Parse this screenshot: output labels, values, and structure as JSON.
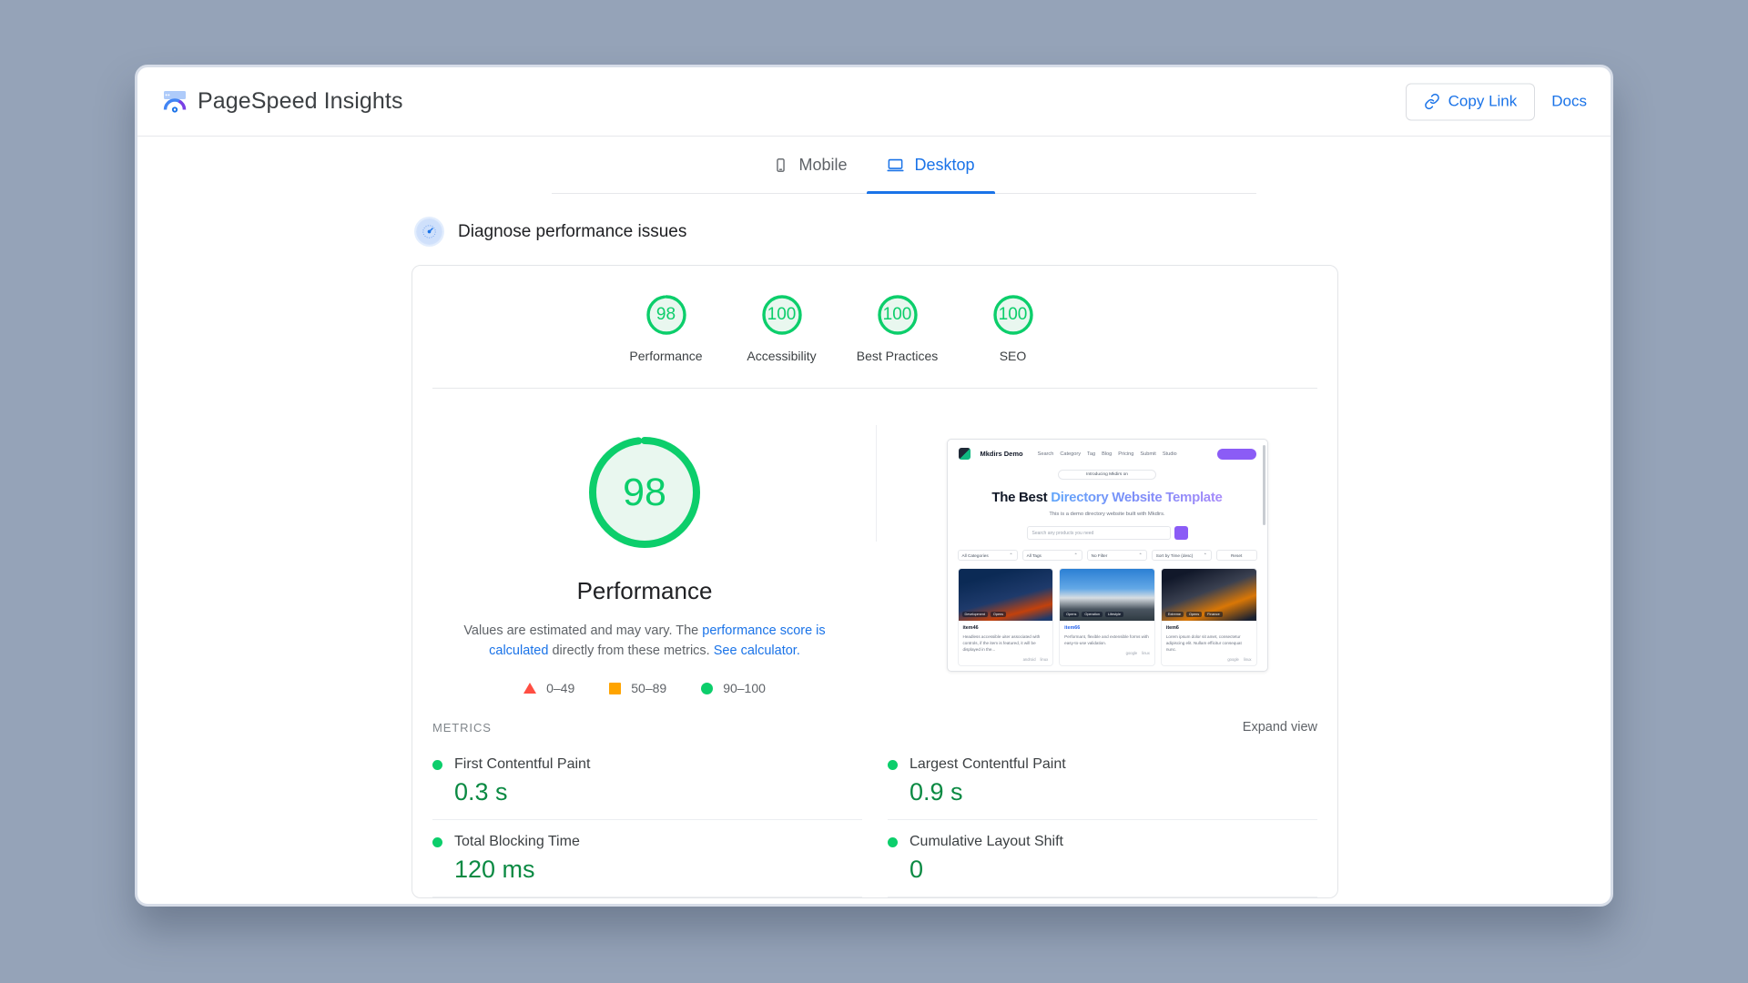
{
  "header": {
    "brand_title": "PageSpeed Insights",
    "logo_icon": "pagespeed-logo-icon",
    "copy_link_label": "Copy Link",
    "copy_link_icon": "link-icon",
    "docs_label": "Docs"
  },
  "tabs": [
    {
      "label": "Mobile",
      "icon": "mobile-phone-icon",
      "active": false
    },
    {
      "label": "Desktop",
      "icon": "desktop-monitor-icon",
      "active": true
    }
  ],
  "diagnose": {
    "title": "Diagnose performance issues",
    "icon": "speedometer-icon"
  },
  "category_scores": [
    {
      "label": "Performance",
      "value": "98",
      "color": "#0cce6b"
    },
    {
      "label": "Accessibility",
      "value": "100",
      "color": "#0cce6b"
    },
    {
      "label": "Best Practices",
      "value": "100",
      "color": "#0cce6b"
    },
    {
      "label": "SEO",
      "value": "100",
      "color": "#0cce6b"
    }
  ],
  "main_score": {
    "value": "98",
    "label": "Performance",
    "desc_part1": "Values are estimated and may vary. The ",
    "desc_link1": "performance score is calculated",
    "desc_part2": " directly from these metrics. ",
    "desc_link2": "See calculator.",
    "ring_color": "#0cce6b",
    "fill_color": "#e9f7ef"
  },
  "legend": [
    {
      "shape": "triangle",
      "color": "#ff4e42",
      "range": "0–49"
    },
    {
      "shape": "square",
      "color": "#ffa400",
      "range": "50–89"
    },
    {
      "shape": "circle",
      "color": "#0cce6b",
      "range": "90–100"
    }
  ],
  "metrics_section": {
    "title": "METRICS",
    "expand_label": "Expand view",
    "items": [
      {
        "name": "First Contentful Paint",
        "value": "0.3 s",
        "status_color": "#0cce6b"
      },
      {
        "name": "Largest Contentful Paint",
        "value": "0.9 s",
        "status_color": "#0cce6b"
      },
      {
        "name": "Total Blocking Time",
        "value": "120 ms",
        "status_color": "#0cce6b"
      },
      {
        "name": "Cumulative Layout Shift",
        "value": "0",
        "status_color": "#0cce6b"
      }
    ]
  },
  "site_screenshot": {
    "brand": "Mkdirs Demo",
    "nav_links": [
      "Search",
      "Category",
      "Tag",
      "Blog",
      "Pricing",
      "Submit",
      "Studio"
    ],
    "badge_text": "Introducing Mkdirs on",
    "heading_bold": "The Best",
    "heading_gradient": "Directory Website Template",
    "subheading": "This is a demo directory website built with Mkdirs.",
    "search_placeholder": "Search any products you need",
    "filters": [
      "All Categories",
      "All Tags",
      "No Filter",
      "Sort by Time (desc)"
    ],
    "reset_label": "Reset",
    "cards": [
      {
        "title": "item46",
        "chips": [
          "Development",
          "Opens"
        ],
        "desc": "Headless accessible uiter associated with controls, if the item is featured, it will be displayed in the...",
        "meta": [
          "android",
          "linux"
        ]
      },
      {
        "title": "item66",
        "chips": [
          "Opens",
          "Operation",
          "Lifestyle"
        ],
        "desc": "Performant, flexible and extensible forms with easy-to-use validation.",
        "meta": [
          "google",
          "linux"
        ]
      },
      {
        "title": "item6",
        "chips": [
          "Extreme",
          "Opens",
          "Finance"
        ],
        "desc": "Lorem ipsum dolor sit amet, consectetur adipiscing elit. Nullam efficitur consequat nunc.",
        "meta": [
          "google",
          "linux"
        ]
      }
    ]
  }
}
